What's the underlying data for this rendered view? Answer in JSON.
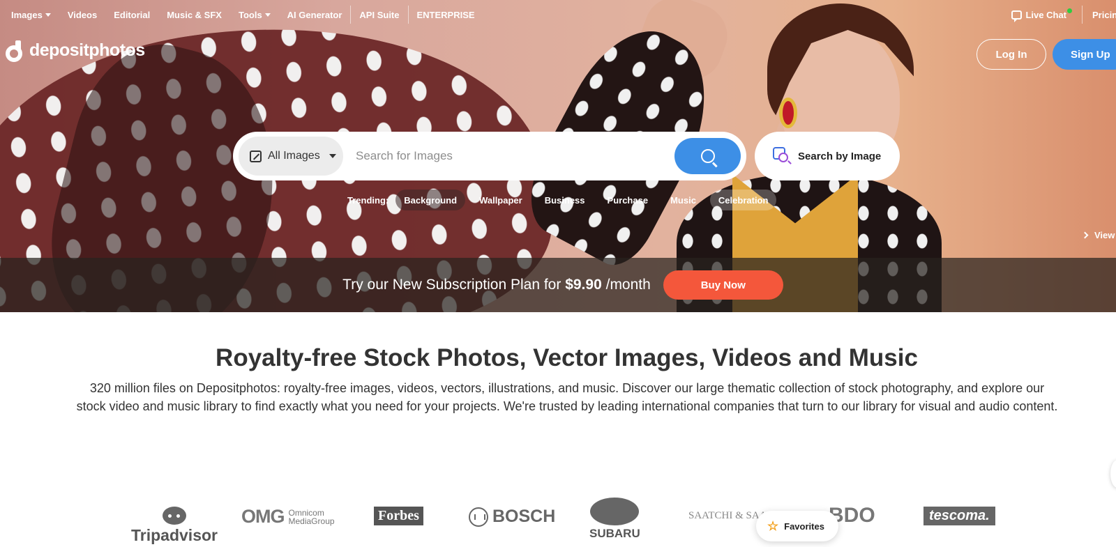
{
  "nav": {
    "items": [
      {
        "label": "Images",
        "dropdown": true
      },
      {
        "label": "Videos",
        "dropdown": false
      },
      {
        "label": "Editorial",
        "dropdown": false
      },
      {
        "label": "Music & SFX",
        "dropdown": false
      },
      {
        "label": "Tools",
        "dropdown": true
      },
      {
        "label": "AI Generator",
        "dropdown": false
      },
      {
        "label": "API Suite",
        "dropdown": false
      },
      {
        "label": "ENTERPRISE",
        "dropdown": false
      }
    ],
    "live_chat": "Live Chat",
    "pricing": "Pricing"
  },
  "header": {
    "logo": "depositphotos",
    "login": "Log In",
    "signup": "Sign Up"
  },
  "search": {
    "type": "All Images",
    "placeholder": "Search for Images",
    "by_image": "Search by Image"
  },
  "trending": {
    "label": "Trending:",
    "chips": [
      "Background",
      "Wallpaper",
      "Business",
      "Purchase",
      "Music",
      "Celebration"
    ]
  },
  "hero": {
    "view_link": "View"
  },
  "promo": {
    "text_before": "Try our New Subscription Plan for",
    "price": "$9.90",
    "text_after": "/month",
    "button": "Buy Now"
  },
  "content": {
    "title": "Royalty-free Stock Photos, Vector Images, Videos and Music",
    "description": "320 million files on Depositphotos: royalty-free images, videos, vectors, illustrations, and music. Discover our large thematic collection of stock photography, and explore our stock video and music library to find exactly what you need for your projects. We're trusted by leading international companies that turn to our library for visual and audio content."
  },
  "brands": {
    "tripadvisor": "Tripadvisor",
    "omg_mark": "OMG",
    "omg_sub1": "Omnicom",
    "omg_sub2": "MediaGroup",
    "forbes": "Forbes",
    "bosch": "BOSCH",
    "subaru": "SUBARU",
    "saatchi": "SAATCHI & SAATCHI",
    "bdo": "BDO",
    "tescoma": "tescoma."
  },
  "favorites": {
    "label": "Favorites"
  },
  "colors": {
    "accent_blue": "#3d8fe6",
    "buy_orange": "#f4573b"
  }
}
